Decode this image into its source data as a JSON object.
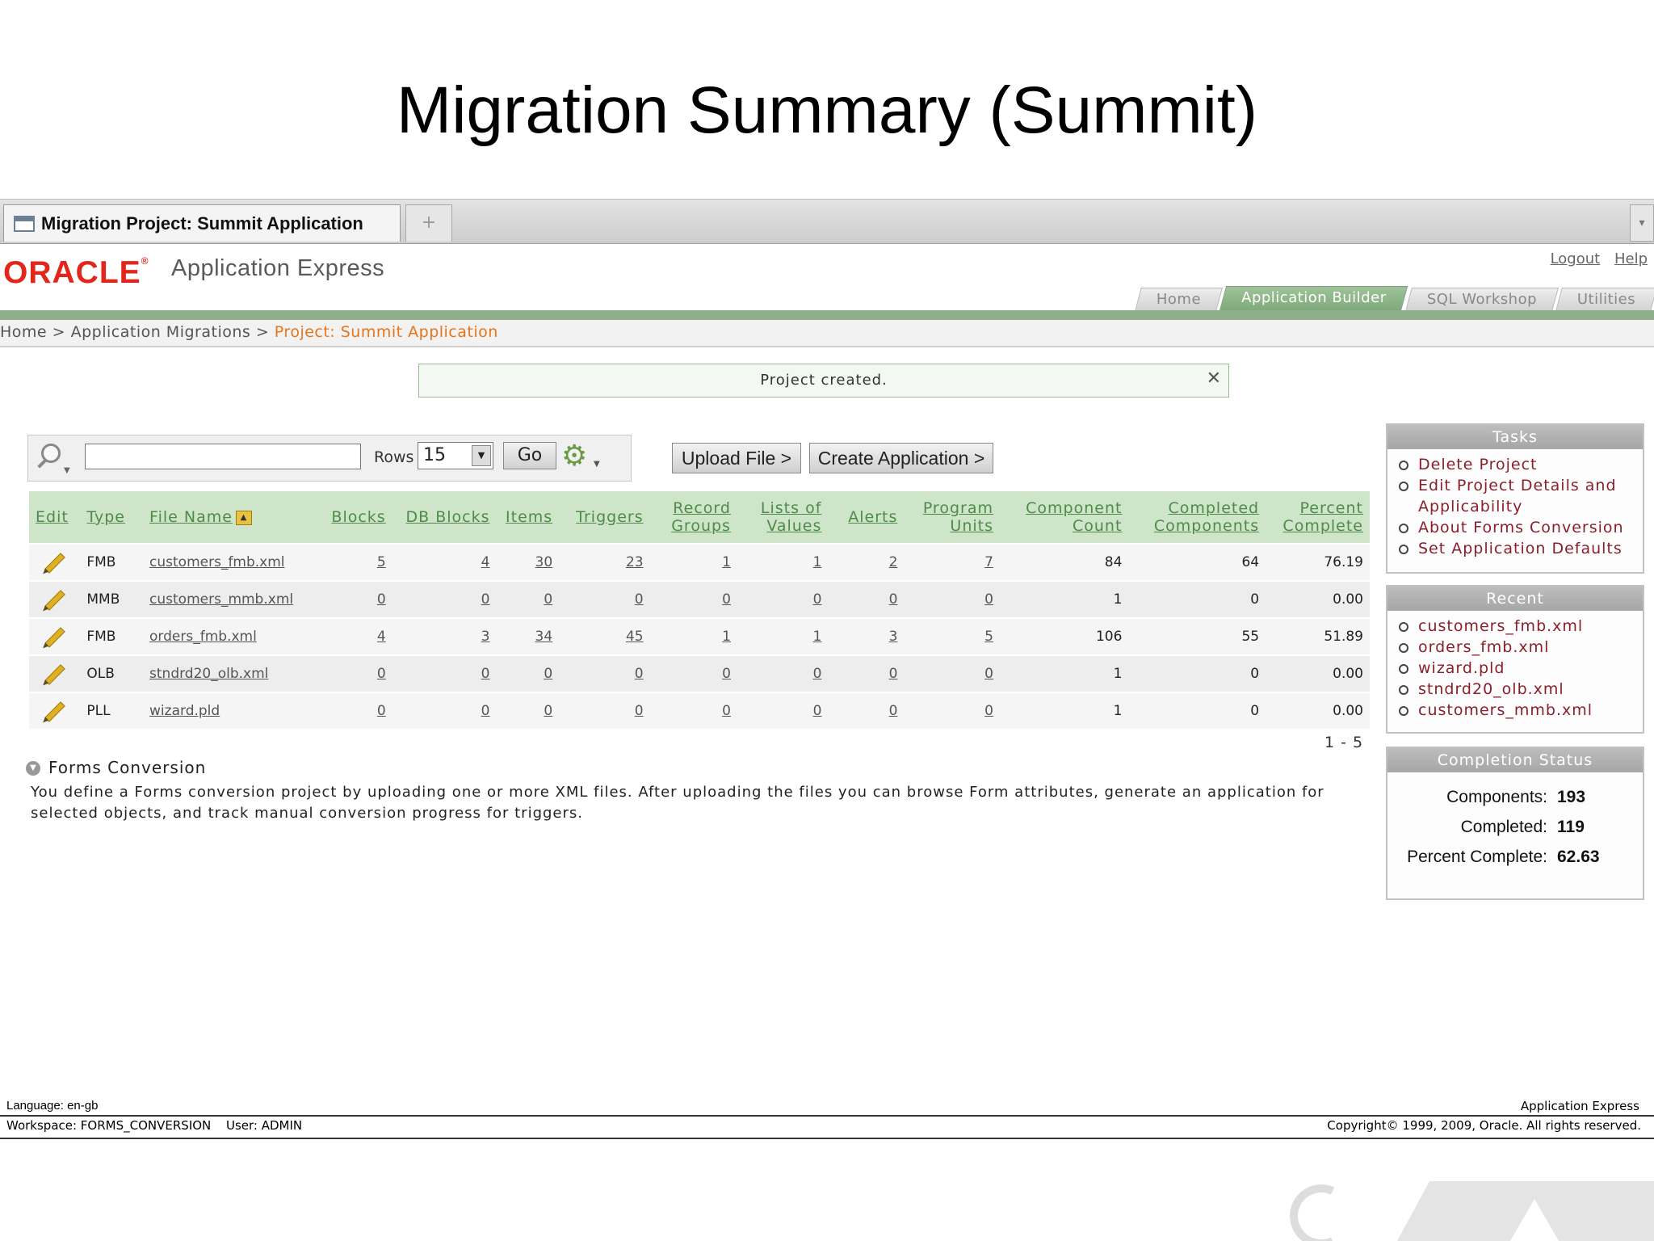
{
  "slide": {
    "title": "Migration Summary (Summit)"
  },
  "browser": {
    "tab_title": "Migration Project: Summit Application",
    "new_tab": "+",
    "tab_menu": "▾"
  },
  "header": {
    "logo": "ORACLE",
    "logo_reg": "®",
    "app_name": "Application Express",
    "links": [
      "Logout",
      "Help"
    ],
    "tabs": [
      {
        "label": "Home",
        "active": false
      },
      {
        "label": "Application Builder",
        "active": true
      },
      {
        "label": "SQL Workshop",
        "active": false
      },
      {
        "label": "Utilities",
        "active": false
      }
    ]
  },
  "breadcrumb": {
    "items": [
      "Home",
      "Application Migrations"
    ],
    "sep": " > ",
    "current": "Project: Summit Application"
  },
  "notification": {
    "message": "Project created.",
    "close": "✕"
  },
  "search": {
    "query": "",
    "rows_label": "Rows",
    "rows_value": "15",
    "go_label": "Go"
  },
  "actions": {
    "upload": "Upload File >",
    "create": "Create Application >"
  },
  "report": {
    "columns": [
      "Edit",
      "Type",
      "File Name",
      "Blocks",
      "DB Blocks",
      "Items",
      "Triggers",
      "Record Groups",
      "Lists of Values",
      "Alerts",
      "Program Units",
      "Component Count",
      "Completed Components",
      "Percent Complete"
    ],
    "rows": [
      [
        "FMB",
        "customers_fmb.xml",
        "5",
        "4",
        "30",
        "23",
        "1",
        "1",
        "2",
        "7",
        "84",
        "64",
        "76.19"
      ],
      [
        "MMB",
        "customers_mmb.xml",
        "0",
        "0",
        "0",
        "0",
        "0",
        "0",
        "0",
        "0",
        "1",
        "0",
        "0.00"
      ],
      [
        "FMB",
        "orders_fmb.xml",
        "4",
        "3",
        "34",
        "45",
        "1",
        "1",
        "3",
        "5",
        "106",
        "55",
        "51.89"
      ],
      [
        "OLB",
        "stndrd20_olb.xml",
        "0",
        "0",
        "0",
        "0",
        "0",
        "0",
        "0",
        "0",
        "1",
        "0",
        "0.00"
      ],
      [
        "PLL",
        "wizard.pld",
        "0",
        "0",
        "0",
        "0",
        "0",
        "0",
        "0",
        "0",
        "1",
        "0",
        "0.00"
      ]
    ],
    "pagination": "1 - 5"
  },
  "forms_conversion": {
    "title": "Forms Conversion",
    "text": "You define a Forms conversion project by uploading one or more XML files. After uploading the files you can browse Form attributes, generate an application for selected objects, and track manual conversion progress for triggers."
  },
  "sidebar": {
    "tasks": {
      "title": "Tasks",
      "items": [
        "Delete Project",
        "Edit Project Details and Applicability",
        "About Forms Conversion",
        "Set Application Defaults"
      ]
    },
    "recent": {
      "title": "Recent",
      "items": [
        "customers_fmb.xml",
        "orders_fmb.xml",
        "wizard.pld",
        "stndrd20_olb.xml",
        "customers_mmb.xml"
      ]
    },
    "status": {
      "title": "Completion Status",
      "rows": [
        {
          "label": "Components:",
          "value": "193"
        },
        {
          "label": "Completed:",
          "value": "119"
        },
        {
          "label": "Percent Complete:",
          "value": "62.63"
        }
      ]
    }
  },
  "footer": {
    "language": "Language: en-gb",
    "app": "Application Express",
    "workspace": "Workspace: FORMS_CONVERSION",
    "user": "User: ADMIN",
    "copyright": "Copyright© 1999, 2009, Oracle. All rights reserved."
  }
}
